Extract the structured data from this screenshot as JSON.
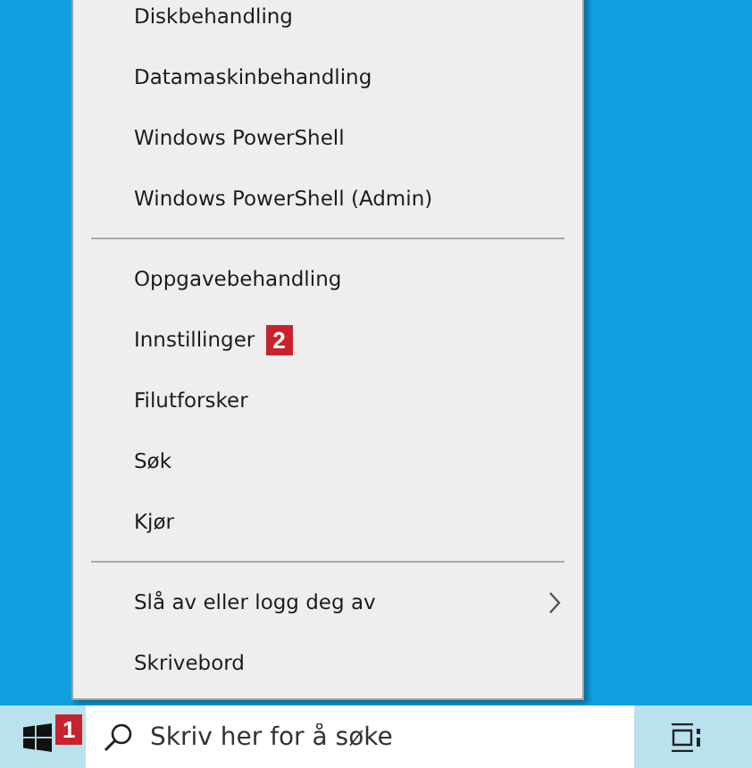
{
  "menu": {
    "groups": [
      {
        "items": [
          {
            "label": "Diskbehandling",
            "kind": "plain"
          },
          {
            "label": "Datamaskinbehandling",
            "kind": "plain"
          },
          {
            "label": "Windows PowerShell",
            "kind": "plain"
          },
          {
            "label": "Windows PowerShell (Admin)",
            "kind": "plain"
          }
        ]
      },
      {
        "items": [
          {
            "label": "Oppgavebehandling",
            "kind": "plain"
          },
          {
            "label": "Innstillinger",
            "kind": "badge",
            "badge": "2"
          },
          {
            "label": "Filutforsker",
            "kind": "plain"
          },
          {
            "label": "Søk",
            "kind": "plain"
          },
          {
            "label": "Kjør",
            "kind": "plain"
          }
        ]
      },
      {
        "items": [
          {
            "label": "Slå av eller logg deg av",
            "kind": "submenu"
          },
          {
            "label": "Skrivebord",
            "kind": "plain"
          }
        ]
      }
    ]
  },
  "taskbar": {
    "start_badge": "1",
    "search": {
      "placeholder": "Skriv her for å søke"
    }
  }
}
